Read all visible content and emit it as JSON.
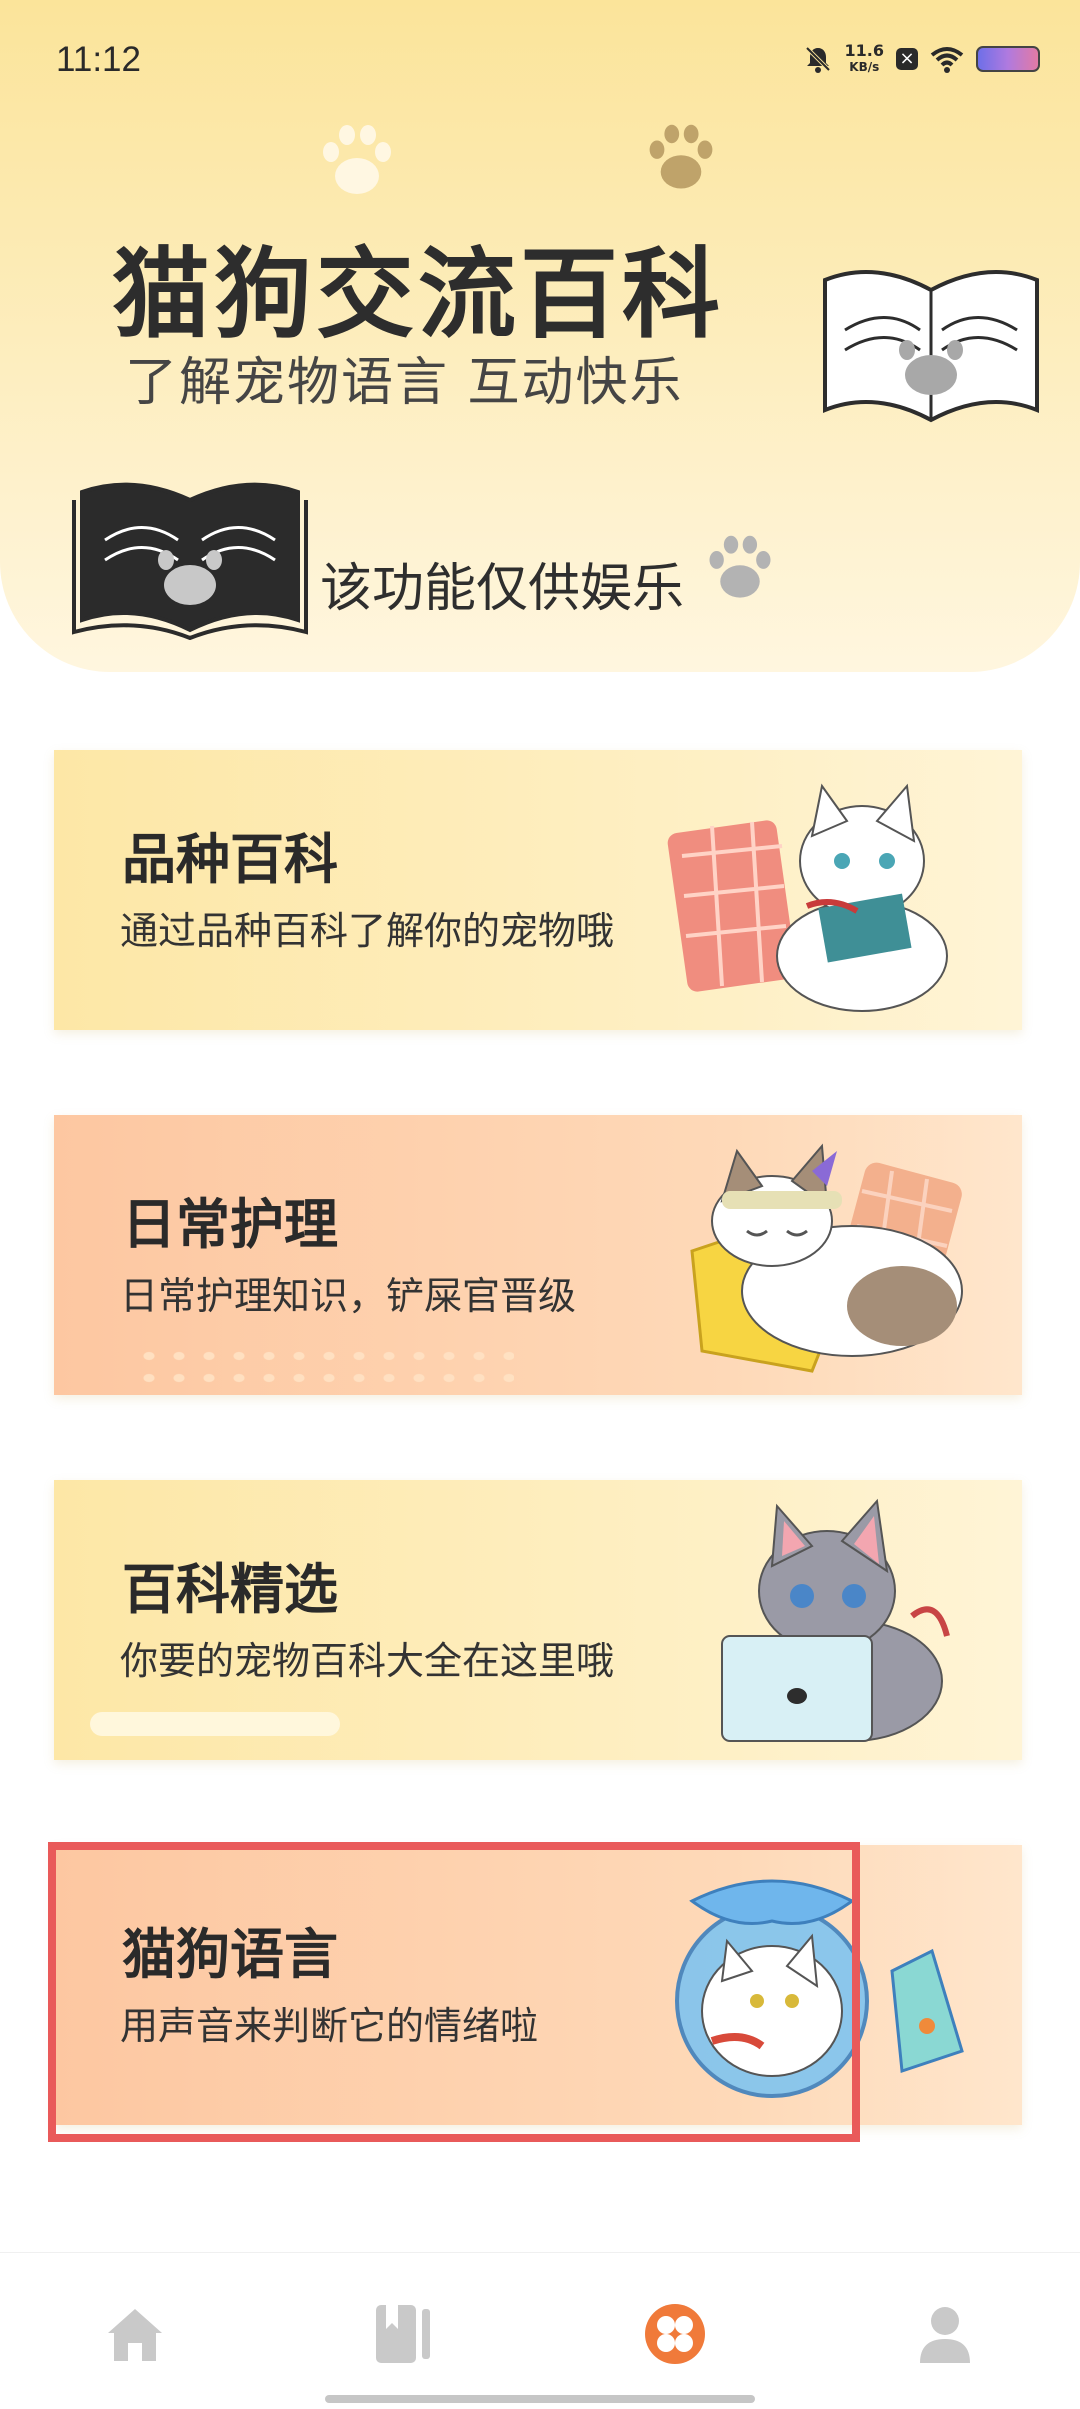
{
  "status_bar": {
    "time": "11:12",
    "net_speed_value": "11.6",
    "net_speed_unit": "KB/s"
  },
  "header": {
    "title": "猫狗交流百科",
    "subtitle": "了解宠物语言  互动快乐",
    "disclaimer": "该功能仅供娱乐"
  },
  "cards": [
    {
      "title": "品种百科",
      "subtitle": "通过品种百科了解你的宠物哦"
    },
    {
      "title": "日常护理",
      "subtitle": "日常护理知识，铲屎官晋级"
    },
    {
      "title": "百科精选",
      "subtitle": "你要的宠物百科大全在这里哦"
    },
    {
      "title": "猫狗语言",
      "subtitle": "用声音来判断它的情绪啦"
    }
  ],
  "nav": [
    {
      "icon": "home-icon",
      "active": false
    },
    {
      "icon": "book-icon",
      "active": false
    },
    {
      "icon": "clover-icon",
      "active": true
    },
    {
      "icon": "user-icon",
      "active": false
    }
  ],
  "colors": {
    "active_nav": "#f07a3a",
    "inactive_nav": "#c9c9c9",
    "highlight_border": "#e95a5a"
  }
}
